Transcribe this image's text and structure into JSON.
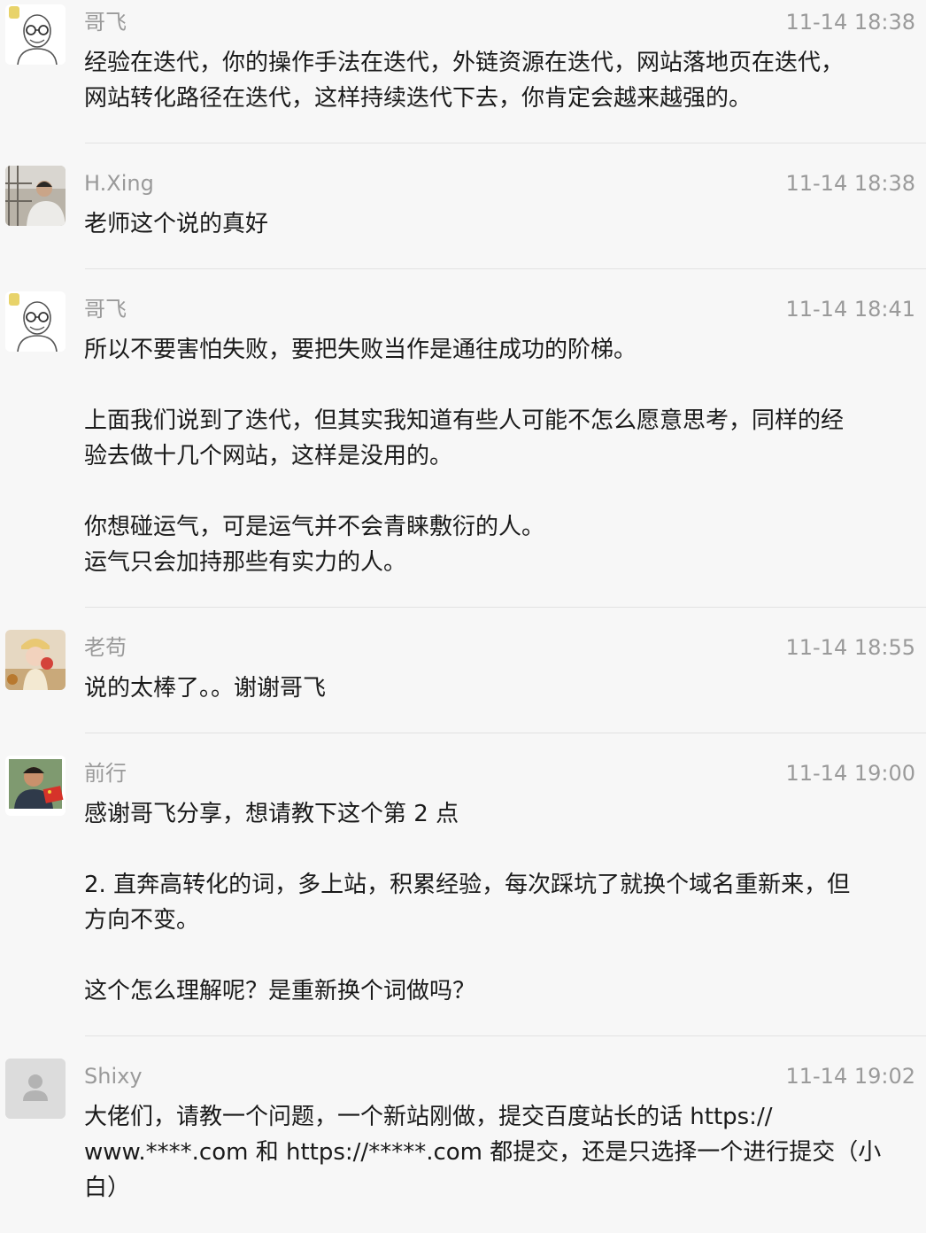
{
  "comments": [
    {
      "author": "哥飞",
      "time": "11-14 18:38",
      "avatar": "bald-glasses-cartoon-avatar",
      "paragraphs": [
        "经验在迭代，你的操作手法在迭代，外链资源在迭代，网站落地页在迭代，\n网站转化路径在迭代，这样持续迭代下去，你肯定会越来越强的。"
      ]
    },
    {
      "author": "H.Xing",
      "time": "11-14 18:38",
      "avatar": "photo-avatar-man",
      "paragraphs": [
        "老师这个说的真好"
      ]
    },
    {
      "author": "哥飞",
      "time": "11-14 18:41",
      "avatar": "bald-glasses-cartoon-avatar",
      "paragraphs": [
        "所以不要害怕失败，要把失败当作是通往成功的阶梯。",
        "上面我们说到了迭代，但其实我知道有些人可能不怎么愿意思考，同样的经\n验去做十几个网站，这样是没用的。",
        "你想碰运气，可是运气并不会青睐敷衍的人。\n运气只会加持那些有实力的人。"
      ]
    },
    {
      "author": "老苟",
      "time": "11-14 18:55",
      "avatar": "photo-avatar-child",
      "paragraphs": [
        "说的太棒了。。谢谢哥飞"
      ]
    },
    {
      "author": "前行",
      "time": "11-14 19:00",
      "avatar": "photo-avatar-man-flag",
      "paragraphs": [
        "感谢哥飞分享，想请教下这个第 2 点",
        "2. 直奔高转化的词，多上站，积累经验，每次踩坑了就换个域名重新来，但\n方向不变。",
        "这个怎么理解呢？是重新换个词做吗？"
      ]
    },
    {
      "author": "Shixy",
      "time": "11-14 19:02",
      "avatar": "default-user-avatar",
      "paragraphs": [
        "大佬们，请教一个问题，一个新站刚做，提交百度站长的话 https://\nwww.****.com 和 https://*****.com 都提交，还是只选择一个进行提交（小\n白）"
      ]
    }
  ]
}
